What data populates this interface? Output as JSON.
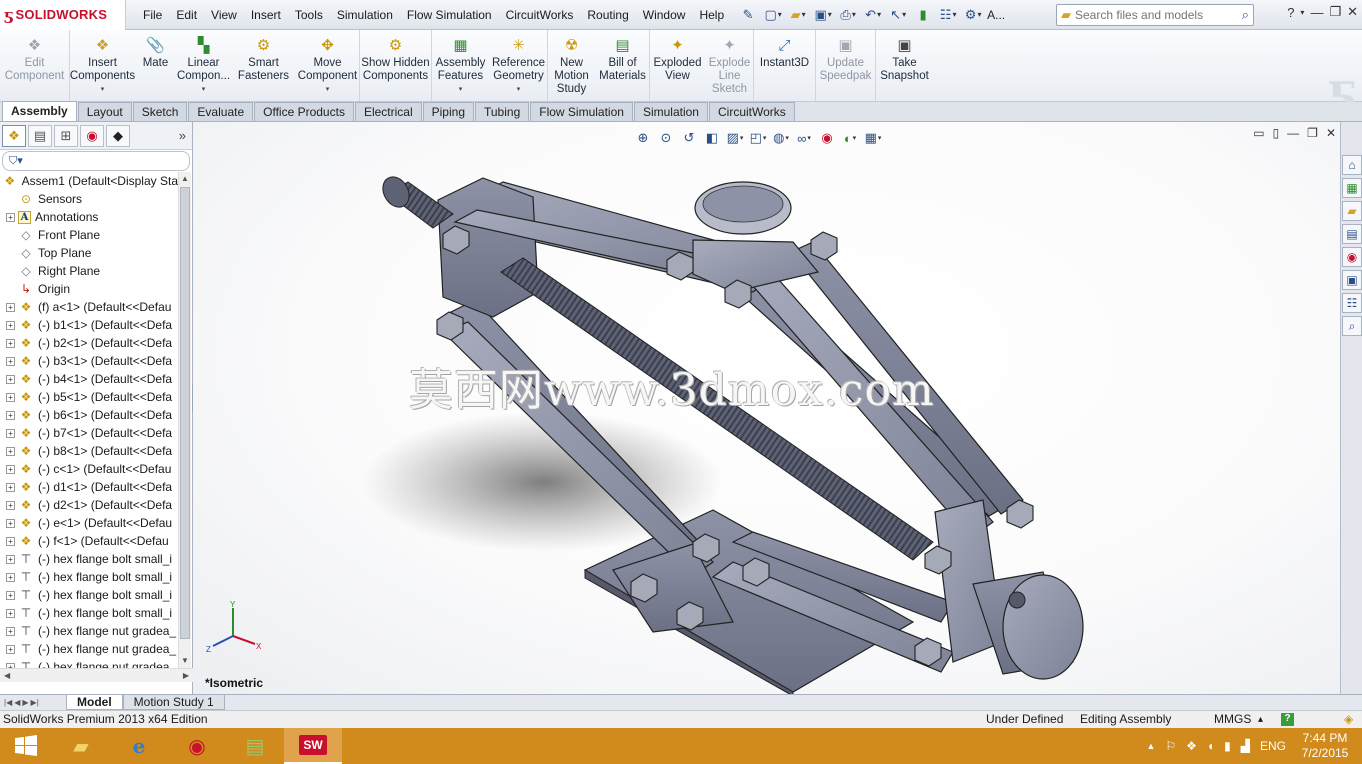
{
  "app": {
    "brand": "SOLIDWORKS",
    "menus": [
      "File",
      "Edit",
      "View",
      "Insert",
      "Tools",
      "Simulation",
      "Flow Simulation",
      "CircuitWorks",
      "Routing",
      "Window",
      "Help"
    ],
    "search_placeholder": "Search files and models",
    "title_truncated": "A..."
  },
  "command_manager": [
    {
      "label": "Edit Component",
      "icon": "edit-component-icon",
      "disabled": true
    },
    {
      "label": "Insert Components",
      "icon": "insert-components-icon"
    },
    {
      "label": "Mate",
      "icon": "mate-icon"
    },
    {
      "label": "Linear Compon...",
      "icon": "linear-pattern-icon"
    },
    {
      "label": "Smart Fasteners",
      "icon": "smart-fasteners-icon"
    },
    {
      "label": "Move Component",
      "icon": "move-component-icon"
    },
    {
      "label": "Show Hidden Components",
      "icon": "show-hidden-icon"
    },
    {
      "label": "Assembly Features",
      "icon": "assembly-features-icon"
    },
    {
      "label": "Reference Geometry",
      "icon": "reference-geometry-icon"
    },
    {
      "label": "New Motion Study",
      "icon": "motion-study-icon"
    },
    {
      "label": "Bill of Materials",
      "icon": "bom-icon"
    },
    {
      "label": "Exploded View",
      "icon": "exploded-view-icon"
    },
    {
      "label": "Explode Line Sketch",
      "icon": "explode-line-icon",
      "disabled": true
    },
    {
      "label": "Instant3D",
      "icon": "instant3d-icon"
    },
    {
      "label": "Update Speedpak",
      "icon": "speedpak-icon",
      "disabled": true
    },
    {
      "label": "Take Snapshot",
      "icon": "snapshot-icon"
    }
  ],
  "tabs": [
    "Assembly",
    "Layout",
    "Sketch",
    "Evaluate",
    "Office Products",
    "Electrical",
    "Piping",
    "Tubing",
    "Flow Simulation",
    "Simulation",
    "CircuitWorks"
  ],
  "active_tab": "Assembly",
  "tree": {
    "root": "Assem1  (Default<Display Sta",
    "items": [
      {
        "label": "Sensors",
        "type": "sensor",
        "expand": false
      },
      {
        "label": "Annotations",
        "type": "annot",
        "expand": true
      },
      {
        "label": "Front Plane",
        "type": "plane",
        "expand": false
      },
      {
        "label": "Top Plane",
        "type": "plane",
        "expand": false
      },
      {
        "label": "Right Plane",
        "type": "plane",
        "expand": false
      },
      {
        "label": "Origin",
        "type": "origin",
        "expand": false
      },
      {
        "label": "(f) a<1> (Default<<Defau",
        "type": "part",
        "expand": true
      },
      {
        "label": "(-) b1<1> (Default<<Defa",
        "type": "part",
        "expand": true
      },
      {
        "label": "(-) b2<1> (Default<<Defa",
        "type": "part",
        "expand": true
      },
      {
        "label": "(-) b3<1> (Default<<Defa",
        "type": "part",
        "expand": true
      },
      {
        "label": "(-) b4<1> (Default<<Defa",
        "type": "part",
        "expand": true
      },
      {
        "label": "(-) b5<1> (Default<<Defa",
        "type": "part",
        "expand": true
      },
      {
        "label": "(-) b6<1> (Default<<Defa",
        "type": "part",
        "expand": true
      },
      {
        "label": "(-) b7<1> (Default<<Defa",
        "type": "part",
        "expand": true
      },
      {
        "label": "(-) b8<1> (Default<<Defa",
        "type": "part",
        "expand": true
      },
      {
        "label": "(-) c<1> (Default<<Defau",
        "type": "part",
        "expand": true
      },
      {
        "label": "(-) d1<1> (Default<<Defa",
        "type": "part",
        "expand": true
      },
      {
        "label": "(-) d2<1> (Default<<Defa",
        "type": "part",
        "expand": true
      },
      {
        "label": "(-) e<1> (Default<<Defau",
        "type": "part",
        "expand": true
      },
      {
        "label": "(-) f<1> (Default<<Defau",
        "type": "part",
        "expand": true
      },
      {
        "label": "(-) hex flange bolt small_i",
        "type": "bolt",
        "expand": true
      },
      {
        "label": "(-) hex flange bolt small_i",
        "type": "bolt",
        "expand": true
      },
      {
        "label": "(-) hex flange bolt small_i",
        "type": "bolt",
        "expand": true
      },
      {
        "label": "(-) hex flange bolt small_i",
        "type": "bolt",
        "expand": true
      },
      {
        "label": "(-) hex flange nut gradea_",
        "type": "bolt",
        "expand": true
      },
      {
        "label": "(-) hex flange nut gradea_",
        "type": "bolt",
        "expand": true
      },
      {
        "label": "(-) hex flange nut gradea",
        "type": "bolt",
        "expand": true
      }
    ]
  },
  "viewport": {
    "watermark": "莫西网www.3dmox.com",
    "view_name": "*Isometric",
    "axis_x": "X",
    "axis_y": "Y",
    "axis_z": "Z"
  },
  "bottom_tabs": [
    "Model",
    "Motion Study 1"
  ],
  "status": {
    "edition": "SolidWorks Premium 2013 x64 Edition",
    "state": "Under Defined",
    "mode": "Editing Assembly",
    "units": "MMGS",
    "units_arrow": "▴",
    "help": "?"
  },
  "taskbar": {
    "lang": "ENG",
    "time": "7:44 PM",
    "date": "7/2/2015"
  }
}
